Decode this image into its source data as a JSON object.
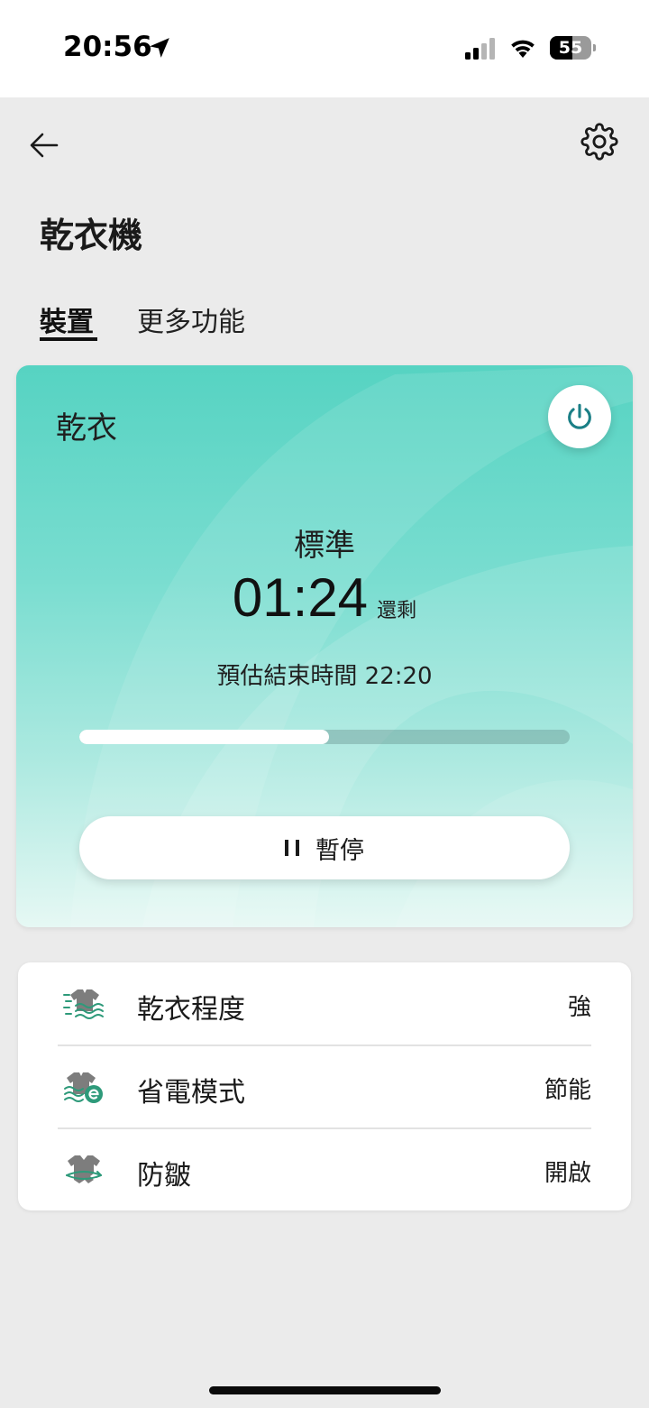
{
  "status_bar": {
    "time": "20:56",
    "battery_level": "55",
    "battery_fraction": 0.55,
    "icons": [
      "location-arrow-icon",
      "cellular-signal-icon",
      "wifi-icon",
      "battery-icon"
    ]
  },
  "header": {
    "back_icon": "arrow-left-icon",
    "settings_icon": "gear-icon",
    "title": "乾衣機"
  },
  "tabs": [
    {
      "label": "裝置",
      "active": true
    },
    {
      "label": "更多功能",
      "active": false
    }
  ],
  "dryer_card": {
    "title": "乾衣",
    "power_icon": "power-icon",
    "mode": "標準",
    "time_remaining": "01:24",
    "remaining_label": "還剩",
    "end_time": "預估結束時間 22:20",
    "progress": 0.51,
    "pause_label": "暫停",
    "pause_icon": "pause-icon"
  },
  "settings": {
    "rows": [
      {
        "label": "乾衣程度",
        "value": "強",
        "icon": "dry-level-icon"
      },
      {
        "label": "省電模式",
        "value": "節能",
        "icon": "eco-mode-icon"
      },
      {
        "label": "防皺",
        "value": "開啟",
        "icon": "anti-wrinkle-icon"
      }
    ]
  },
  "colors": {
    "accent_teal": "#56d3c2",
    "power_icon": "#1a7f86",
    "icon_green": "#2e9a7a",
    "icon_gray": "#7d7d7d",
    "background": "#ebebeb"
  }
}
